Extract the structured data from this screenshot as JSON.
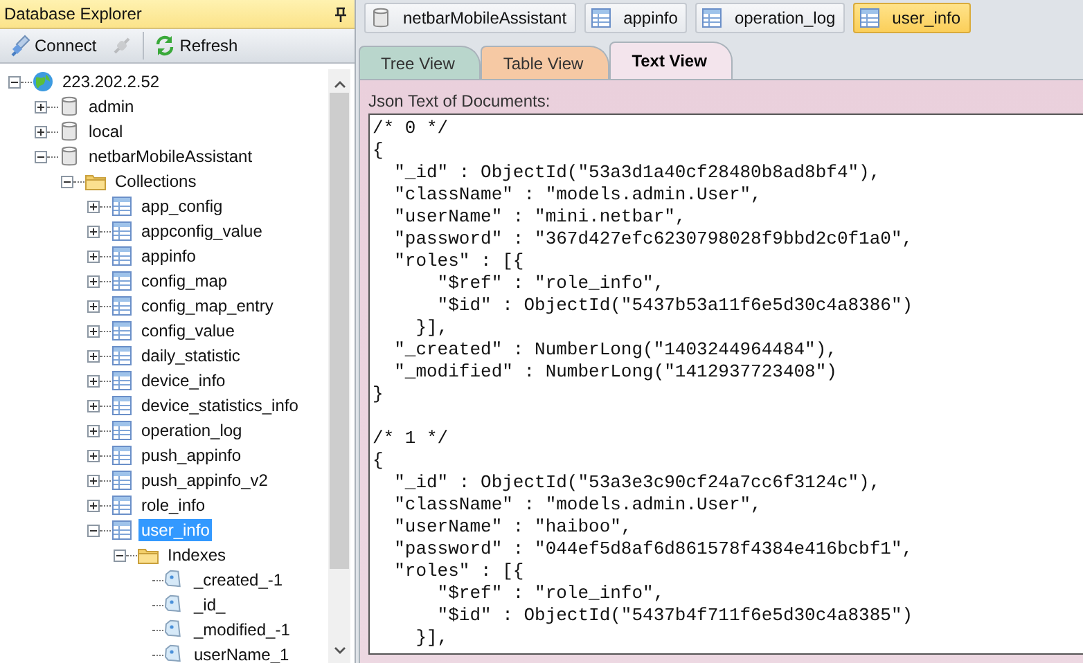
{
  "explorer": {
    "title": "Database Explorer",
    "toolbar": [
      {
        "kind": "connect",
        "label": "Connect",
        "disabled": false
      },
      {
        "kind": "disconnect",
        "disabled": true
      },
      {
        "kind": "refresh",
        "label": "Refresh",
        "disabled": false
      }
    ],
    "tree": [
      {
        "kind": "server",
        "label": "223.202.2.52",
        "expanded": true,
        "selected": false,
        "children": [
          {
            "kind": "database",
            "label": "admin",
            "expanded": false,
            "selected": false
          },
          {
            "kind": "database",
            "label": "local",
            "expanded": false,
            "selected": false
          },
          {
            "kind": "database",
            "label": "netbarMobileAssistant",
            "expanded": true,
            "selected": false,
            "children": [
              {
                "kind": "folder",
                "label": "Collections",
                "expanded": true,
                "selected": false,
                "children": [
                  {
                    "kind": "collection",
                    "label": "app_config",
                    "expanded": false,
                    "selected": false
                  },
                  {
                    "kind": "collection",
                    "label": "appconfig_value",
                    "expanded": false,
                    "selected": false
                  },
                  {
                    "kind": "collection",
                    "label": "appinfo",
                    "expanded": false,
                    "selected": false
                  },
                  {
                    "kind": "collection",
                    "label": "config_map",
                    "expanded": false,
                    "selected": false
                  },
                  {
                    "kind": "collection",
                    "label": "config_map_entry",
                    "expanded": false,
                    "selected": false
                  },
                  {
                    "kind": "collection",
                    "label": "config_value",
                    "expanded": false,
                    "selected": false
                  },
                  {
                    "kind": "collection",
                    "label": "daily_statistic",
                    "expanded": false,
                    "selected": false
                  },
                  {
                    "kind": "collection",
                    "label": "device_info",
                    "expanded": false,
                    "selected": false
                  },
                  {
                    "kind": "collection",
                    "label": "device_statistics_info",
                    "expanded": false,
                    "selected": false
                  },
                  {
                    "kind": "collection",
                    "label": "operation_log",
                    "expanded": false,
                    "selected": false
                  },
                  {
                    "kind": "collection",
                    "label": "push_appinfo",
                    "expanded": false,
                    "selected": false
                  },
                  {
                    "kind": "collection",
                    "label": "push_appinfo_v2",
                    "expanded": false,
                    "selected": false
                  },
                  {
                    "kind": "collection",
                    "label": "role_info",
                    "expanded": false,
                    "selected": false
                  },
                  {
                    "kind": "collection",
                    "label": "user_info",
                    "expanded": true,
                    "selected": true,
                    "children": [
                      {
                        "kind": "folder",
                        "label": "Indexes",
                        "expanded": true,
                        "selected": false,
                        "children": [
                          {
                            "kind": "index",
                            "label": "_created_-1",
                            "selected": false
                          },
                          {
                            "kind": "index",
                            "label": "_id_",
                            "selected": false
                          },
                          {
                            "kind": "index",
                            "label": "_modified_-1",
                            "selected": false
                          },
                          {
                            "kind": "index",
                            "label": "userName_1",
                            "selected": false
                          }
                        ]
                      }
                    ]
                  }
                ]
              }
            ]
          }
        ]
      }
    ]
  },
  "document_tabs": [
    {
      "kind": "database",
      "label": "netbarMobileAssistant",
      "selected": false
    },
    {
      "kind": "collection",
      "label": "appinfo",
      "selected": false
    },
    {
      "kind": "collection",
      "label": "operation_log",
      "selected": false
    },
    {
      "kind": "collection",
      "label": "user_info",
      "selected": true
    }
  ],
  "view_tabs": [
    {
      "label": "Tree View",
      "selected": false,
      "color": "#b9d6cc"
    },
    {
      "label": "Table View",
      "selected": false,
      "color": "#f6c9a4"
    },
    {
      "label": "Text View",
      "selected": true,
      "color": "#f3e4ec"
    }
  ],
  "text_view": {
    "label": "Json Text of Documents:",
    "documents": [
      {
        "lines": [
          "/* 0 */",
          "{",
          "  \"_id\" : ObjectId(\"53a3d1a40cf28480b8ad8bf4\"),",
          "  \"className\" : \"models.admin.User\",",
          "  \"userName\" : \"mini.netbar\",",
          "  \"password\" : \"367d427efc6230798028f9bbd2c0f1a0\",",
          "  \"roles\" : [{",
          "      \"$ref\" : \"role_info\",",
          "      \"$id\" : ObjectId(\"5437b53a11f6e5d30c4a8386\")",
          "    }],",
          "  \"_created\" : NumberLong(\"1403244964484\"),",
          "  \"_modified\" : NumberLong(\"1412937723408\")",
          "}"
        ]
      },
      {
        "lines": [
          "/* 1 */",
          "{",
          "  \"_id\" : ObjectId(\"53a3e3c90cf24a7cc6f3124c\"),",
          "  \"className\" : \"models.admin.User\",",
          "  \"userName\" : \"haiboo\",",
          "  \"password\" : \"044ef5d8af6d861578f4384e416bcbf1\",",
          "  \"roles\" : [{",
          "      \"$ref\" : \"role_info\",",
          "      \"$id\" : ObjectId(\"5437b4f711f6e5d30c4a8385\")",
          "    }],"
        ]
      }
    ]
  }
}
